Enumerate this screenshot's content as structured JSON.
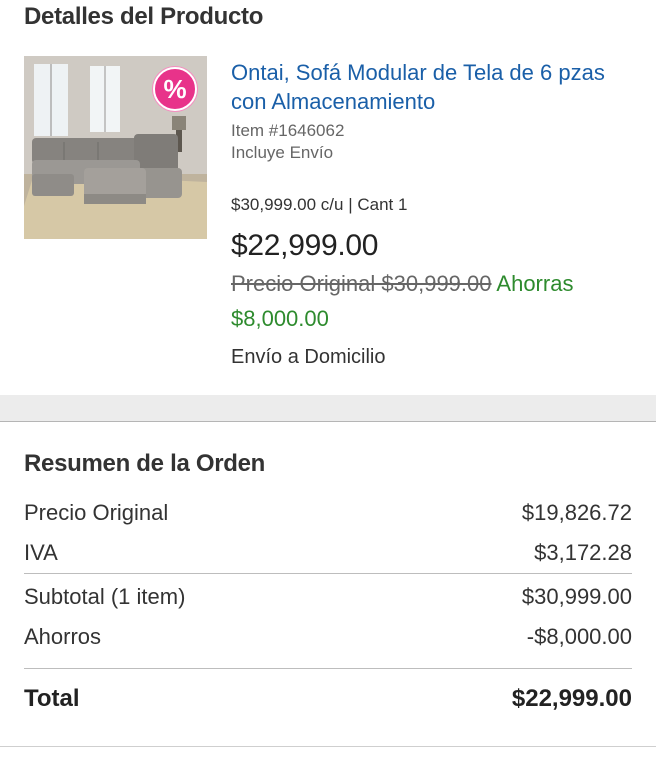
{
  "product_details": {
    "header": "Detalles del Producto",
    "name": "Ontai, Sofá Modular de Tela de 6 pzas con Almacenamiento",
    "item_number": "Item #1646062",
    "shipping_included": "Incluye Envío",
    "unit_price_line": "$30,999.00 c/u | Cant 1",
    "current_price": "$22,999.00",
    "original_price_label": "Precio Original $30,999.00",
    "savings_label": "Ahorras $8,000.00",
    "delivery_method": "Envío a Domicilio",
    "badge": "%",
    "icons": {
      "discount_badge": "percent-badge-icon"
    }
  },
  "order_summary": {
    "header": "Resumen de la Orden",
    "rows": [
      {
        "label": "Precio Original",
        "value": "$19,826.72"
      },
      {
        "label": "IVA",
        "value": "$3,172.28"
      },
      {
        "label": "Subtotal (1 item)",
        "value": "$30,999.00"
      },
      {
        "label": "Ahorros",
        "value": "-$8,000.00"
      }
    ],
    "total": {
      "label": "Total",
      "value": "$22,999.00"
    }
  },
  "colors": {
    "link_blue": "#1a5fa8",
    "savings_green": "#2e8b2e",
    "badge_pink": "#e8338a"
  }
}
